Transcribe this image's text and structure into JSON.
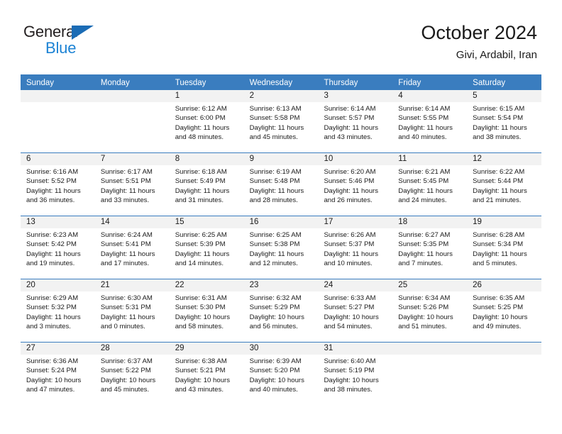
{
  "logo": {
    "word_top": "General",
    "word_bottom": "Blue",
    "triangle_color": "#1b6cb5",
    "blue_color": "#1d83d4"
  },
  "header": {
    "title": "October 2024",
    "subtitle": "Givi, Ardabil, Iran"
  },
  "theme": {
    "header_bar": "#3a7dbf",
    "day_strip": "#f2f2f2",
    "text": "#1a1a1a"
  },
  "weekday_headers": [
    "Sunday",
    "Monday",
    "Tuesday",
    "Wednesday",
    "Thursday",
    "Friday",
    "Saturday"
  ],
  "weeks": [
    [
      {
        "day": "",
        "lines": []
      },
      {
        "day": "",
        "lines": []
      },
      {
        "day": "1",
        "lines": [
          "Sunrise: 6:12 AM",
          "Sunset: 6:00 PM",
          "Daylight: 11 hours",
          "and 48 minutes."
        ]
      },
      {
        "day": "2",
        "lines": [
          "Sunrise: 6:13 AM",
          "Sunset: 5:58 PM",
          "Daylight: 11 hours",
          "and 45 minutes."
        ]
      },
      {
        "day": "3",
        "lines": [
          "Sunrise: 6:14 AM",
          "Sunset: 5:57 PM",
          "Daylight: 11 hours",
          "and 43 minutes."
        ]
      },
      {
        "day": "4",
        "lines": [
          "Sunrise: 6:14 AM",
          "Sunset: 5:55 PM",
          "Daylight: 11 hours",
          "and 40 minutes."
        ]
      },
      {
        "day": "5",
        "lines": [
          "Sunrise: 6:15 AM",
          "Sunset: 5:54 PM",
          "Daylight: 11 hours",
          "and 38 minutes."
        ]
      }
    ],
    [
      {
        "day": "6",
        "lines": [
          "Sunrise: 6:16 AM",
          "Sunset: 5:52 PM",
          "Daylight: 11 hours",
          "and 36 minutes."
        ]
      },
      {
        "day": "7",
        "lines": [
          "Sunrise: 6:17 AM",
          "Sunset: 5:51 PM",
          "Daylight: 11 hours",
          "and 33 minutes."
        ]
      },
      {
        "day": "8",
        "lines": [
          "Sunrise: 6:18 AM",
          "Sunset: 5:49 PM",
          "Daylight: 11 hours",
          "and 31 minutes."
        ]
      },
      {
        "day": "9",
        "lines": [
          "Sunrise: 6:19 AM",
          "Sunset: 5:48 PM",
          "Daylight: 11 hours",
          "and 28 minutes."
        ]
      },
      {
        "day": "10",
        "lines": [
          "Sunrise: 6:20 AM",
          "Sunset: 5:46 PM",
          "Daylight: 11 hours",
          "and 26 minutes."
        ]
      },
      {
        "day": "11",
        "lines": [
          "Sunrise: 6:21 AM",
          "Sunset: 5:45 PM",
          "Daylight: 11 hours",
          "and 24 minutes."
        ]
      },
      {
        "day": "12",
        "lines": [
          "Sunrise: 6:22 AM",
          "Sunset: 5:44 PM",
          "Daylight: 11 hours",
          "and 21 minutes."
        ]
      }
    ],
    [
      {
        "day": "13",
        "lines": [
          "Sunrise: 6:23 AM",
          "Sunset: 5:42 PM",
          "Daylight: 11 hours",
          "and 19 minutes."
        ]
      },
      {
        "day": "14",
        "lines": [
          "Sunrise: 6:24 AM",
          "Sunset: 5:41 PM",
          "Daylight: 11 hours",
          "and 17 minutes."
        ]
      },
      {
        "day": "15",
        "lines": [
          "Sunrise: 6:25 AM",
          "Sunset: 5:39 PM",
          "Daylight: 11 hours",
          "and 14 minutes."
        ]
      },
      {
        "day": "16",
        "lines": [
          "Sunrise: 6:25 AM",
          "Sunset: 5:38 PM",
          "Daylight: 11 hours",
          "and 12 minutes."
        ]
      },
      {
        "day": "17",
        "lines": [
          "Sunrise: 6:26 AM",
          "Sunset: 5:37 PM",
          "Daylight: 11 hours",
          "and 10 minutes."
        ]
      },
      {
        "day": "18",
        "lines": [
          "Sunrise: 6:27 AM",
          "Sunset: 5:35 PM",
          "Daylight: 11 hours",
          "and 7 minutes."
        ]
      },
      {
        "day": "19",
        "lines": [
          "Sunrise: 6:28 AM",
          "Sunset: 5:34 PM",
          "Daylight: 11 hours",
          "and 5 minutes."
        ]
      }
    ],
    [
      {
        "day": "20",
        "lines": [
          "Sunrise: 6:29 AM",
          "Sunset: 5:32 PM",
          "Daylight: 11 hours",
          "and 3 minutes."
        ]
      },
      {
        "day": "21",
        "lines": [
          "Sunrise: 6:30 AM",
          "Sunset: 5:31 PM",
          "Daylight: 11 hours",
          "and 0 minutes."
        ]
      },
      {
        "day": "22",
        "lines": [
          "Sunrise: 6:31 AM",
          "Sunset: 5:30 PM",
          "Daylight: 10 hours",
          "and 58 minutes."
        ]
      },
      {
        "day": "23",
        "lines": [
          "Sunrise: 6:32 AM",
          "Sunset: 5:29 PM",
          "Daylight: 10 hours",
          "and 56 minutes."
        ]
      },
      {
        "day": "24",
        "lines": [
          "Sunrise: 6:33 AM",
          "Sunset: 5:27 PM",
          "Daylight: 10 hours",
          "and 54 minutes."
        ]
      },
      {
        "day": "25",
        "lines": [
          "Sunrise: 6:34 AM",
          "Sunset: 5:26 PM",
          "Daylight: 10 hours",
          "and 51 minutes."
        ]
      },
      {
        "day": "26",
        "lines": [
          "Sunrise: 6:35 AM",
          "Sunset: 5:25 PM",
          "Daylight: 10 hours",
          "and 49 minutes."
        ]
      }
    ],
    [
      {
        "day": "27",
        "lines": [
          "Sunrise: 6:36 AM",
          "Sunset: 5:24 PM",
          "Daylight: 10 hours",
          "and 47 minutes."
        ]
      },
      {
        "day": "28",
        "lines": [
          "Sunrise: 6:37 AM",
          "Sunset: 5:22 PM",
          "Daylight: 10 hours",
          "and 45 minutes."
        ]
      },
      {
        "day": "29",
        "lines": [
          "Sunrise: 6:38 AM",
          "Sunset: 5:21 PM",
          "Daylight: 10 hours",
          "and 43 minutes."
        ]
      },
      {
        "day": "30",
        "lines": [
          "Sunrise: 6:39 AM",
          "Sunset: 5:20 PM",
          "Daylight: 10 hours",
          "and 40 minutes."
        ]
      },
      {
        "day": "31",
        "lines": [
          "Sunrise: 6:40 AM",
          "Sunset: 5:19 PM",
          "Daylight: 10 hours",
          "and 38 minutes."
        ]
      },
      {
        "day": "",
        "lines": []
      },
      {
        "day": "",
        "lines": []
      }
    ]
  ]
}
